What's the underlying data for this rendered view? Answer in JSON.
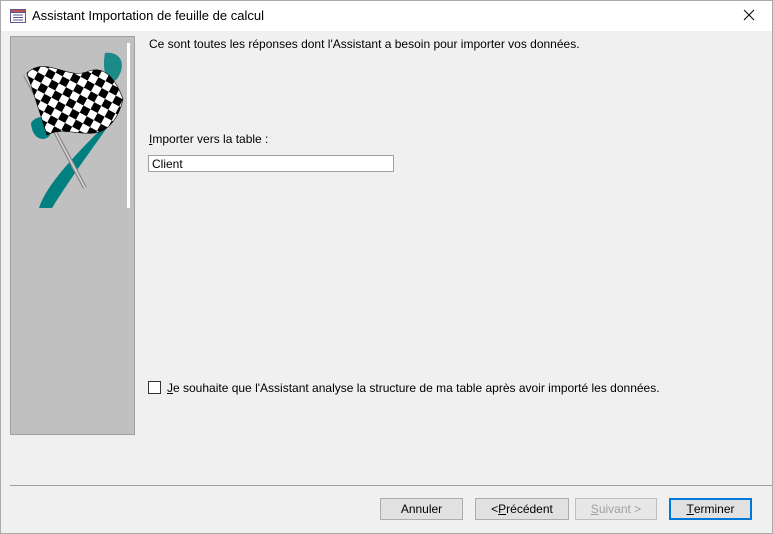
{
  "window": {
    "title": "Assistant Importation de feuille de calcul",
    "close_icon": "close-icon",
    "app_icon": "spreadsheet-import-icon"
  },
  "side_panel": {
    "image": "checkered-flag-illustration"
  },
  "main": {
    "intro_text": "Ce sont toutes les réponses dont l'Assistant a besoin pour importer vos données.",
    "table_label_first": "I",
    "table_label_rest": "mporter vers la table :",
    "table_value": "Client",
    "analyze_checkbox": {
      "checked": false,
      "label_first": "J",
      "label_rest": "e souhaite que l'Assistant analyse la structure de ma table après avoir importé les données."
    }
  },
  "buttons": {
    "cancel": "Annuler",
    "previous_prefix": "< ",
    "previous_ul": "P",
    "previous_rest": "récédent",
    "next_ul": "S",
    "next_rest": "uivant >",
    "finish_ul": "T",
    "finish_rest": "erminer"
  },
  "colors": {
    "flag_teal": "#008080",
    "default_button_border": "#0078d7",
    "side_panel_bg": "#c0c0c0"
  }
}
